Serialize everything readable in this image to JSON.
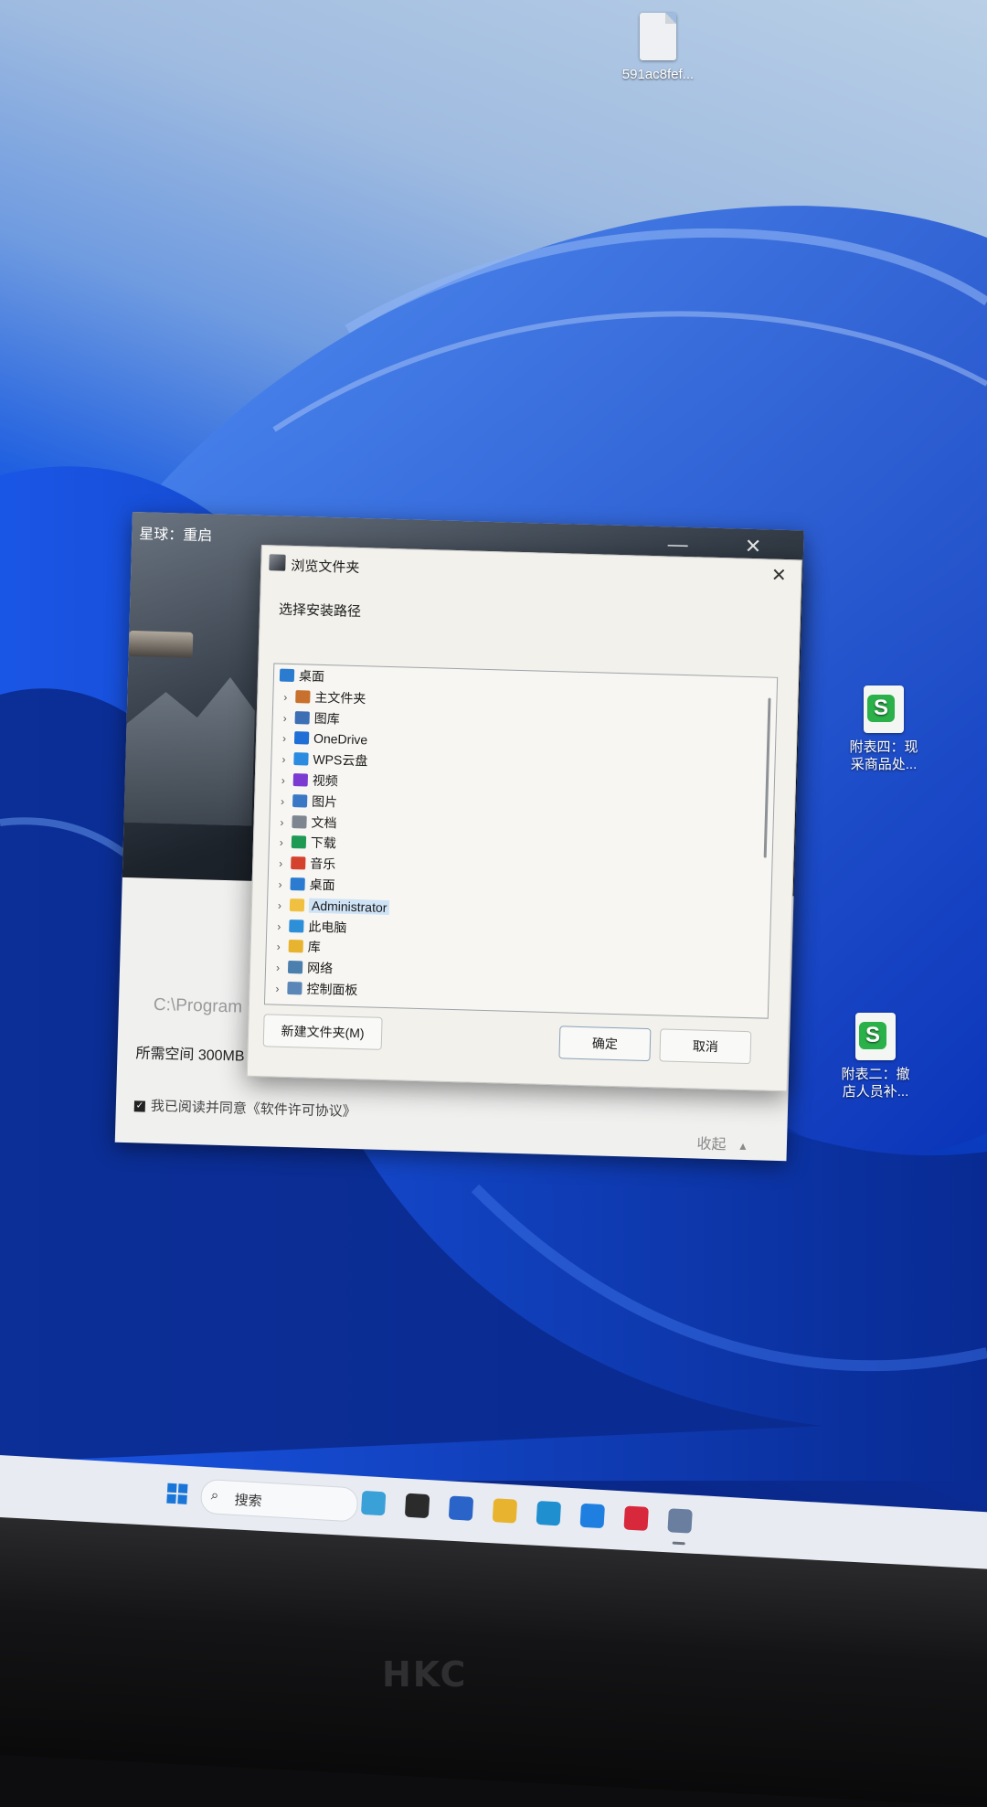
{
  "desktop": {
    "icons": [
      {
        "label": "591ac8fef..."
      },
      {
        "label_line1": "附表四：现",
        "label_line2": "采商品处..."
      },
      {
        "label_line1": "附表二：撤",
        "label_line2": "店人员补..."
      }
    ]
  },
  "installer": {
    "title": "星球：重启",
    "install_path": "C:\\Program",
    "space_text": "所需空间 300MB  剩余空间 65GB",
    "agree_text": "我已阅读并同意《软件许可协议》",
    "collapse_label": "收起"
  },
  "dialog": {
    "title": "浏览文件夹",
    "prompt": "选择安装路径",
    "tree": [
      {
        "label": "桌面",
        "icon": "desktop-icon",
        "root": true
      },
      {
        "label": "主文件夹",
        "icon": "home-icon"
      },
      {
        "label": "图库",
        "icon": "gallery-icon"
      },
      {
        "label": "OneDrive",
        "icon": "cloud-icon"
      },
      {
        "label": "WPS云盘",
        "icon": "wps-cloud-icon"
      },
      {
        "label": "视频",
        "icon": "video-icon"
      },
      {
        "label": "图片",
        "icon": "pictures-icon"
      },
      {
        "label": "文档",
        "icon": "documents-icon"
      },
      {
        "label": "下载",
        "icon": "download-icon"
      },
      {
        "label": "音乐",
        "icon": "music-icon"
      },
      {
        "label": "桌面",
        "icon": "desktop-icon"
      },
      {
        "label": "Administrator",
        "icon": "folder-icon",
        "selected": true
      },
      {
        "label": "此电脑",
        "icon": "computer-icon"
      },
      {
        "label": "库",
        "icon": "library-icon"
      },
      {
        "label": "网络",
        "icon": "network-icon"
      },
      {
        "label": "控制面板",
        "icon": "control-panel-icon"
      }
    ],
    "new_folder_label": "新建文件夹(M)",
    "ok_label": "确定",
    "cancel_label": "取消",
    "close_glyph": "✕"
  },
  "taskbar": {
    "search_placeholder": "搜索",
    "apps": [
      "widgets-icon",
      "task-view-icon",
      "store-icon",
      "file-explorer-icon",
      "edge-icon",
      "feishu-icon",
      "dingtalk-icon",
      "game-installer-icon"
    ]
  },
  "monitor": {
    "brand": "HKC"
  },
  "colors": {
    "accent": "#1976d8",
    "selection": "#cfe3f6",
    "wps_green": "#2bb14a"
  }
}
